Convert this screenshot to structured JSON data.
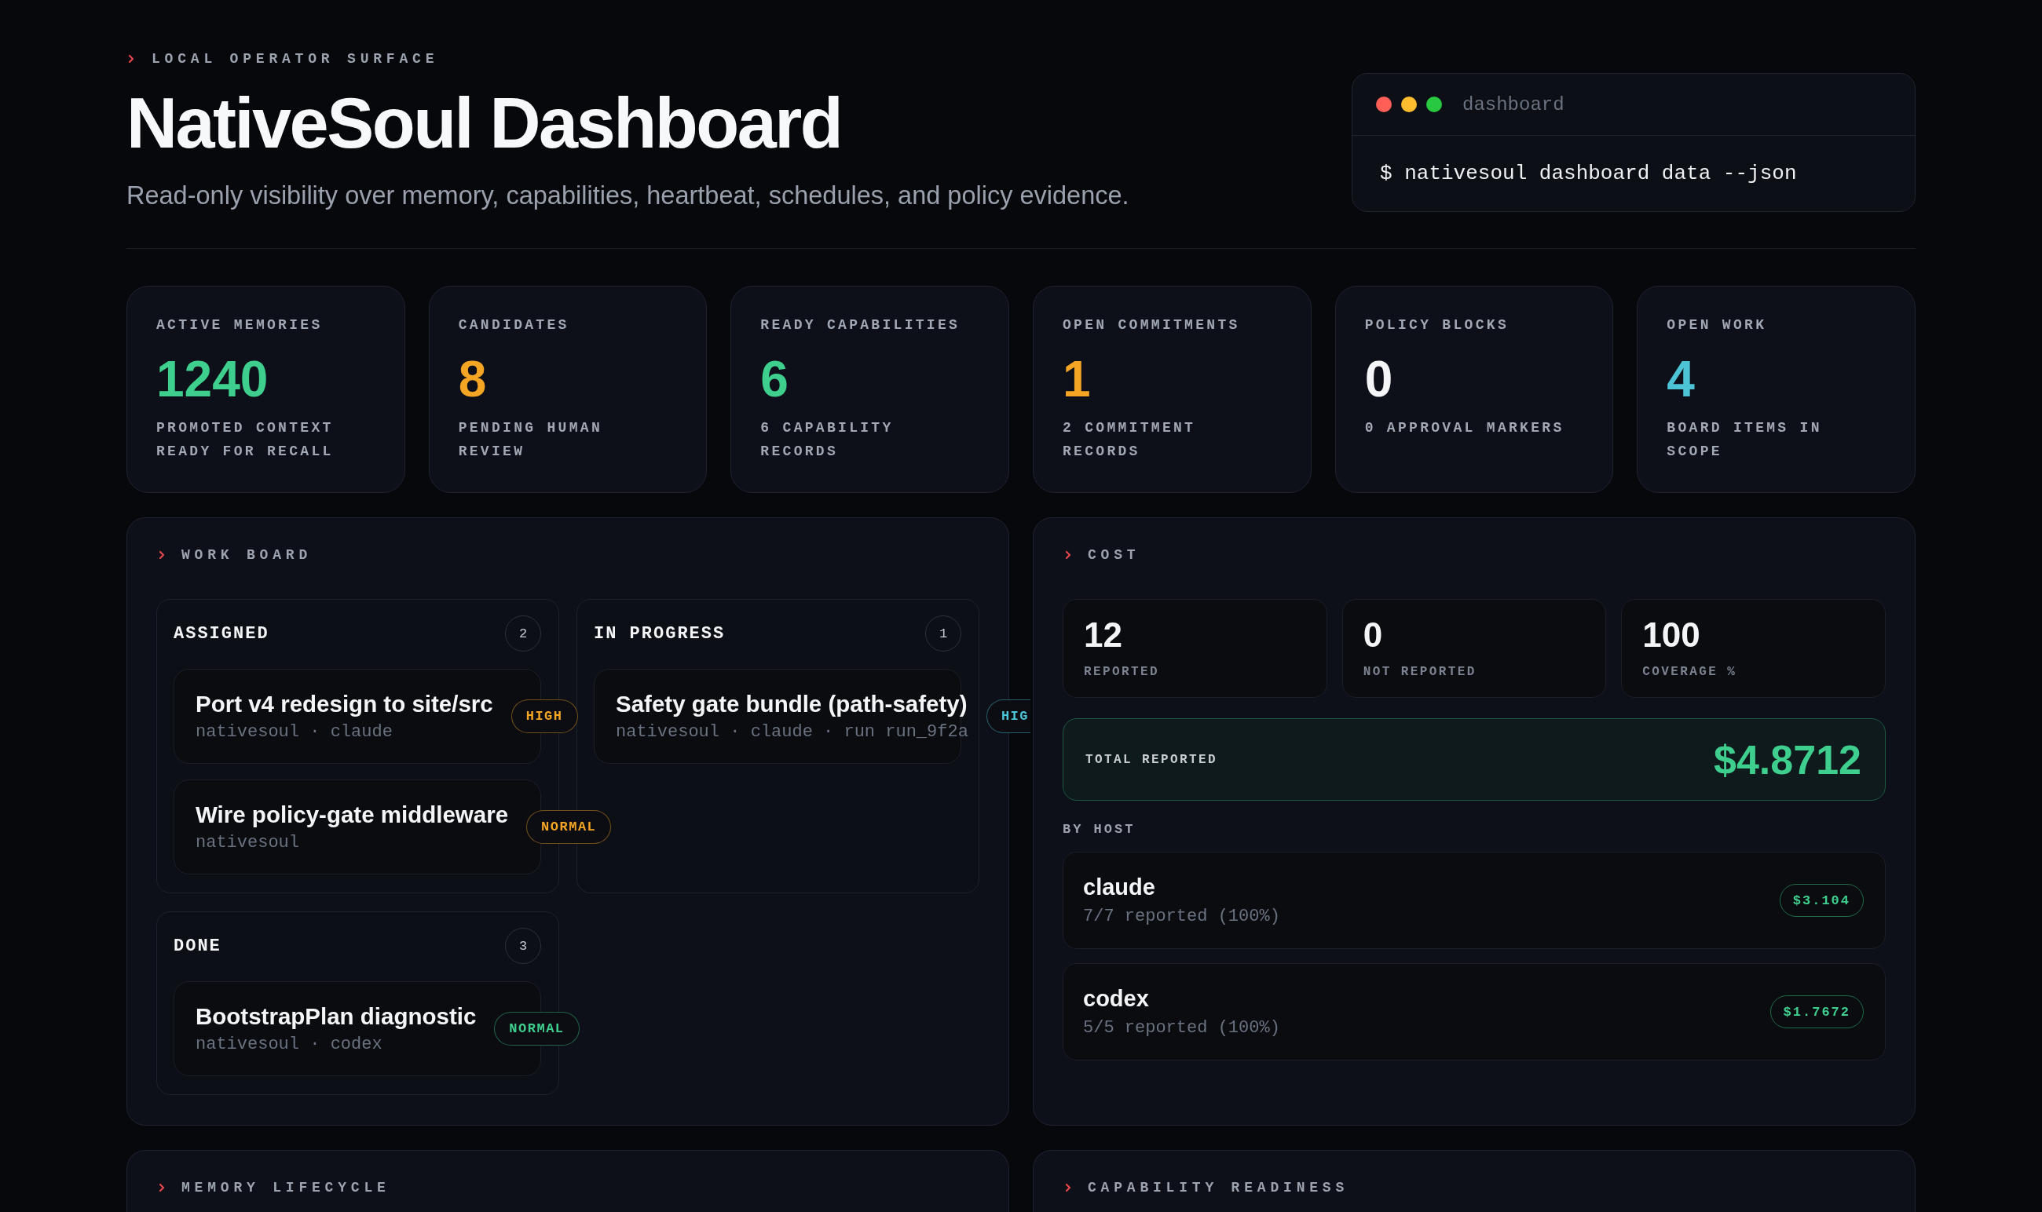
{
  "header": {
    "eyebrow": "LOCAL OPERATOR SURFACE",
    "title": "NativeSoul Dashboard",
    "subtitle": "Read-only visibility over memory, capabilities, heartbeat, schedules, and policy evidence."
  },
  "terminal": {
    "title": "dashboard",
    "command": "$ nativesoul dashboard data --json"
  },
  "stats": [
    {
      "label": "ACTIVE MEMORIES",
      "value": "1240",
      "note": "PROMOTED CONTEXT READY FOR RECALL",
      "color": "#3ecf8e"
    },
    {
      "label": "CANDIDATES",
      "value": "8",
      "note": "PENDING HUMAN REVIEW",
      "color": "#f5a524"
    },
    {
      "label": "READY CAPABILITIES",
      "value": "6",
      "note": "6 CAPABILITY RECORDS",
      "color": "#3ecf8e"
    },
    {
      "label": "OPEN COMMITMENTS",
      "value": "1",
      "note": "2 COMMITMENT RECORDS",
      "color": "#f5a524"
    },
    {
      "label": "POLICY BLOCKS",
      "value": "0",
      "note": "0 APPROVAL MARKERS",
      "color": "#f4f5f7"
    },
    {
      "label": "OPEN WORK",
      "value": "4",
      "note": "BOARD ITEMS IN SCOPE",
      "color": "#4dc4d6"
    }
  ],
  "work_board": {
    "title": "WORK BOARD",
    "columns": [
      {
        "name": "ASSIGNED",
        "count": "2",
        "items": [
          {
            "title": "Port v4 redesign to site/src",
            "meta": "nativesoul · claude",
            "priority": "HIGH",
            "color": "#f5a524",
            "clipped": false
          },
          {
            "title": "Wire policy-gate middleware",
            "meta": "nativesoul",
            "priority": "NORMAL",
            "color": "#f5a524",
            "clipped": false
          }
        ]
      },
      {
        "name": "IN PROGRESS",
        "count": "1",
        "items": [
          {
            "title": "Safety gate bundle (path-safety)",
            "meta": "nativesoul · claude · run run_9f2a",
            "priority": "HIG",
            "color": "#4dc4d6",
            "clipped": true
          }
        ]
      },
      {
        "name": "DONE",
        "count": "3",
        "items": [
          {
            "title": "BootstrapPlan diagnostic",
            "meta": "nativesoul · codex",
            "priority": "NORMAL",
            "color": "#3ecf8e",
            "clipped": false
          }
        ]
      }
    ]
  },
  "cost": {
    "title": "COST",
    "metrics": [
      {
        "value": "12",
        "label": "REPORTED"
      },
      {
        "value": "0",
        "label": "NOT REPORTED"
      },
      {
        "value": "100",
        "label": "COVERAGE %"
      }
    ],
    "total": {
      "label": "TOTAL REPORTED",
      "value": "$4.8712"
    },
    "by_host_label": "BY HOST",
    "hosts": [
      {
        "name": "claude",
        "detail": "7/7 reported (100%)",
        "amount": "$3.104"
      },
      {
        "name": "codex",
        "detail": "5/5 reported (100%)",
        "amount": "$1.7672"
      }
    ]
  },
  "lower_panels": [
    {
      "title": "MEMORY LIFECYCLE"
    },
    {
      "title": "CAPABILITY READINESS"
    }
  ]
}
